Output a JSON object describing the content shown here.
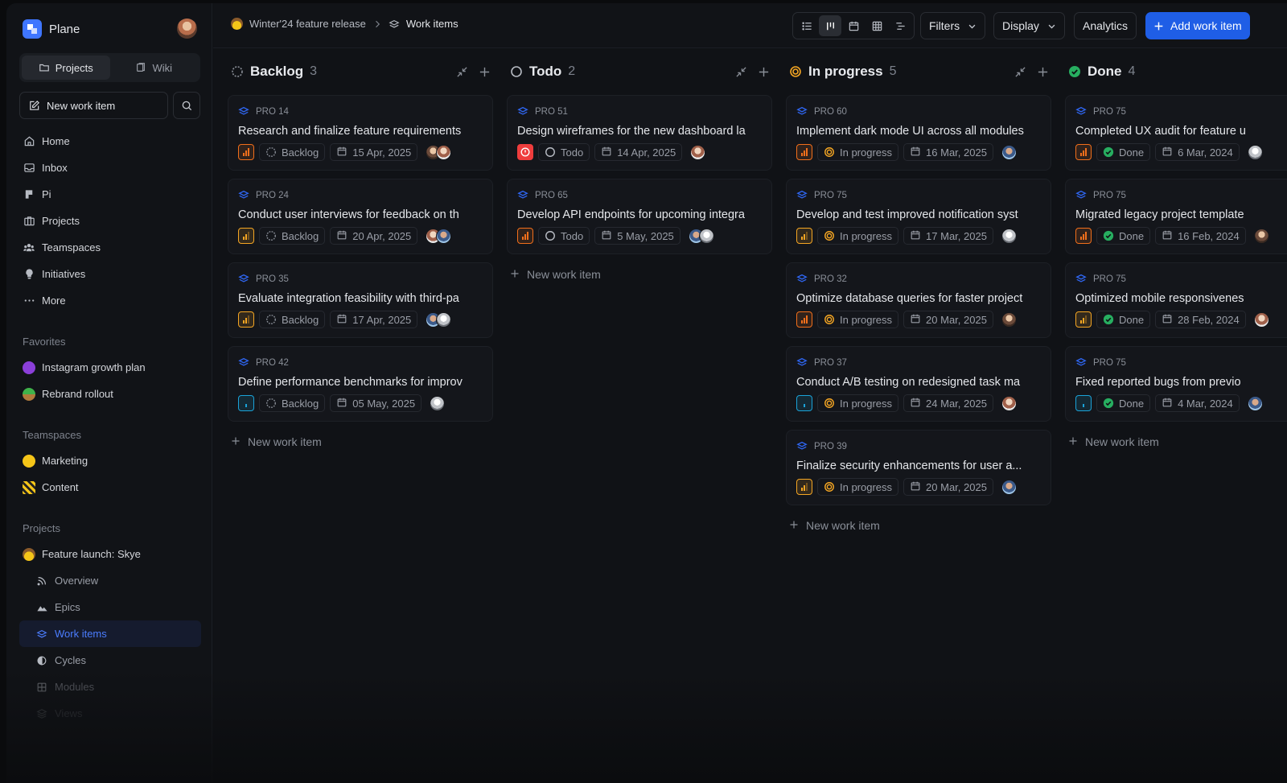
{
  "app": {
    "name": "Plane"
  },
  "sidebar": {
    "tabs": [
      {
        "label": "Projects"
      },
      {
        "label": "Wiki"
      }
    ],
    "new_item_label": "New work item",
    "nav": [
      {
        "label": "Home",
        "icon": "home-icon"
      },
      {
        "label": "Inbox",
        "icon": "inbox-icon"
      },
      {
        "label": "Pi",
        "icon": "pi-icon"
      },
      {
        "label": "Projects",
        "icon": "briefcase-icon"
      },
      {
        "label": "Teamspaces",
        "icon": "team-icon"
      },
      {
        "label": "Initiatives",
        "icon": "initiatives-icon"
      },
      {
        "label": "More",
        "icon": "more-icon"
      }
    ],
    "favorites_title": "Favorites",
    "favorites": [
      {
        "label": "Instagram growth plan"
      },
      {
        "label": "Rebrand rollout"
      }
    ],
    "teamspaces_title": "Teamspaces",
    "teamspaces": [
      {
        "label": "Marketing"
      },
      {
        "label": "Content"
      }
    ],
    "projects_title": "Projects",
    "project": {
      "label": "Feature launch: Skye"
    },
    "project_items": [
      {
        "label": "Overview"
      },
      {
        "label": "Epics"
      },
      {
        "label": "Work items"
      },
      {
        "label": "Cycles"
      },
      {
        "label": "Modules"
      },
      {
        "label": "Views"
      }
    ]
  },
  "header": {
    "breadcrumb": [
      "Winter'24 feature release",
      "Work items"
    ],
    "filters_label": "Filters",
    "display_label": "Display",
    "analytics_label": "Analytics",
    "add_label": "Add work item"
  },
  "colors": {
    "accent": "#1f5ee6",
    "urgent": "#ef3d3d",
    "high": "#f26f1b",
    "medium": "#f5a623",
    "low": "#1aa3d9",
    "done": "#27ae60"
  },
  "board": {
    "new_item_label": "New work item",
    "columns": [
      {
        "title": "Backlog",
        "count": "3",
        "state": "backlog",
        "cards": [
          {
            "id": "PRO 14",
            "title": "Research and finalize feature requirements",
            "priority": "high",
            "state": "Backlog",
            "date": "15 Apr, 2025",
            "avatars": 2
          },
          {
            "id": "PRO 24",
            "title": "Conduct user interviews for feedback on th",
            "priority": "medium",
            "state": "Backlog",
            "date": "20 Apr, 2025",
            "avatars": 2
          },
          {
            "id": "PRO 35",
            "title": "Evaluate integration feasibility with third-pa",
            "priority": "medium",
            "state": "Backlog",
            "date": "17 Apr, 2025",
            "avatars": 2
          },
          {
            "id": "PRO 42",
            "title": "Define performance benchmarks for improv",
            "priority": "low",
            "state": "Backlog",
            "date": "05 May, 2025",
            "avatars": 1
          }
        ]
      },
      {
        "title": "Todo",
        "count": "2",
        "state": "todo",
        "cards": [
          {
            "id": "PRO 51",
            "title": "Design wireframes for the new dashboard la",
            "priority": "urgent",
            "state": "Todo",
            "date": "14 Apr, 2025",
            "avatars": 1
          },
          {
            "id": "PRO 65",
            "title": "Develop API endpoints for upcoming integra",
            "priority": "high",
            "state": "Todo",
            "date": "5 May, 2025",
            "avatars": 2
          }
        ]
      },
      {
        "title": "In progress",
        "count": "5",
        "state": "progress",
        "cards": [
          {
            "id": "PRO 60",
            "title": "Implement dark mode UI across all modules",
            "priority": "high",
            "state": "In progress",
            "date": "16 Mar, 2025",
            "avatars": 1
          },
          {
            "id": "PRO 75",
            "title": "Develop and test improved notification syst",
            "priority": "medium",
            "state": "In progress",
            "date": "17 Mar, 2025",
            "avatars": 1
          },
          {
            "id": "PRO 32",
            "title": "Optimize database queries for faster project",
            "priority": "high",
            "state": "In progress",
            "date": "20 Mar, 2025",
            "avatars": 1
          },
          {
            "id": "PRO 37",
            "title": "Conduct A/B testing on redesigned task ma",
            "priority": "low",
            "state": "In progress",
            "date": "24 Mar, 2025",
            "avatars": 1
          },
          {
            "id": "PRO 39",
            "title": "Finalize security enhancements for user a...",
            "priority": "medium",
            "state": "In progress",
            "date": "20 Mar, 2025",
            "avatars": 1
          }
        ]
      },
      {
        "title": "Done",
        "count": "4",
        "state": "done",
        "cards": [
          {
            "id": "PRO 75",
            "title": "Completed UX audit for feature u",
            "priority": "high",
            "state": "Done",
            "date": "6 Mar, 2024",
            "avatars": 1
          },
          {
            "id": "PRO 75",
            "title": "Migrated legacy project template",
            "priority": "high",
            "state": "Done",
            "date": "16 Feb, 2024",
            "avatars": 1
          },
          {
            "id": "PRO 75",
            "title": "Optimized mobile responsivenes",
            "priority": "medium",
            "state": "Done",
            "date": "28 Feb, 2024",
            "avatars": 1
          },
          {
            "id": "PRO 75",
            "title": "Fixed reported bugs from previo",
            "priority": "low",
            "state": "Done",
            "date": "4 Mar, 2024",
            "avatars": 1
          }
        ]
      }
    ]
  }
}
